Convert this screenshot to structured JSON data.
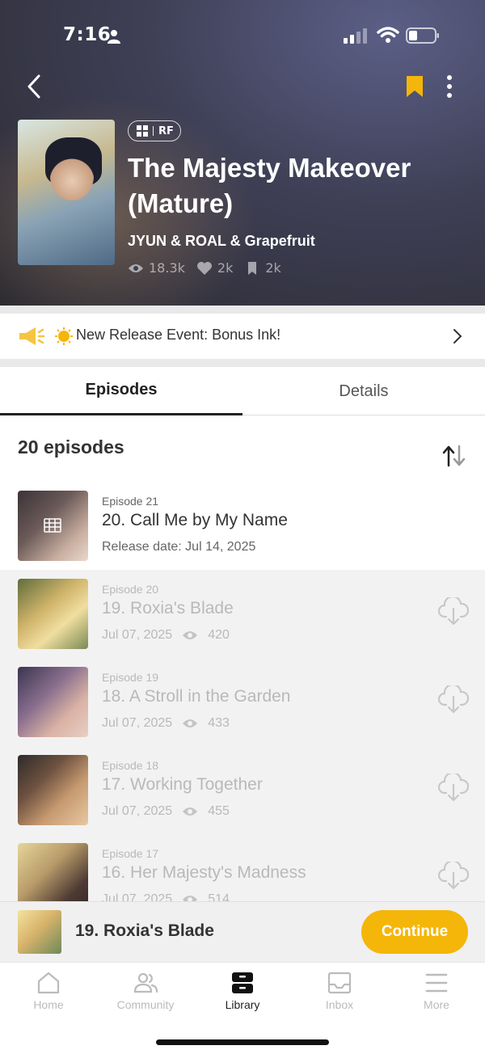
{
  "status_bar": {
    "time": "7:16"
  },
  "header": {
    "badge_label": "RF",
    "title": "The Majesty Makeover (Mature)",
    "authors": "JYUN & ROAL & Grapefruit",
    "stats": {
      "views": "18.3k",
      "likes": "2k",
      "bookmarks": "2k"
    },
    "accent_color": "#F5B60A"
  },
  "event": {
    "text": "New Release Event: Bonus Ink!"
  },
  "tabs": [
    {
      "label": "Episodes",
      "active": true
    },
    {
      "label": "Details",
      "active": false
    }
  ],
  "list": {
    "count_label": "20 episodes",
    "episodes": [
      {
        "number_label": "Episode 21",
        "title": "20. Call Me by My Name",
        "meta": "Release date: Jul 14, 2025",
        "views": "",
        "locked": true
      },
      {
        "number_label": "Episode 20",
        "title": "19. Roxia's Blade",
        "meta": "Jul 07, 2025",
        "views": "420",
        "locked": false
      },
      {
        "number_label": "Episode 19",
        "title": "18. A Stroll in the Garden",
        "meta": "Jul 07, 2025",
        "views": "433",
        "locked": false
      },
      {
        "number_label": "Episode 18",
        "title": "17. Working Together",
        "meta": "Jul 07, 2025",
        "views": "455",
        "locked": false
      },
      {
        "number_label": "Episode 17",
        "title": "16. Her Majesty's Madness",
        "meta": "Jul 07, 2025",
        "views": "514",
        "locked": false
      }
    ]
  },
  "continue_bar": {
    "episode_title": "19. Roxia's Blade",
    "button_label": "Continue"
  },
  "nav": [
    {
      "label": "Home",
      "icon": "home-icon"
    },
    {
      "label": "Community",
      "icon": "community-icon"
    },
    {
      "label": "Library",
      "icon": "library-icon",
      "active": true
    },
    {
      "label": "Inbox",
      "icon": "inbox-icon"
    },
    {
      "label": "More",
      "icon": "menu-icon"
    }
  ]
}
